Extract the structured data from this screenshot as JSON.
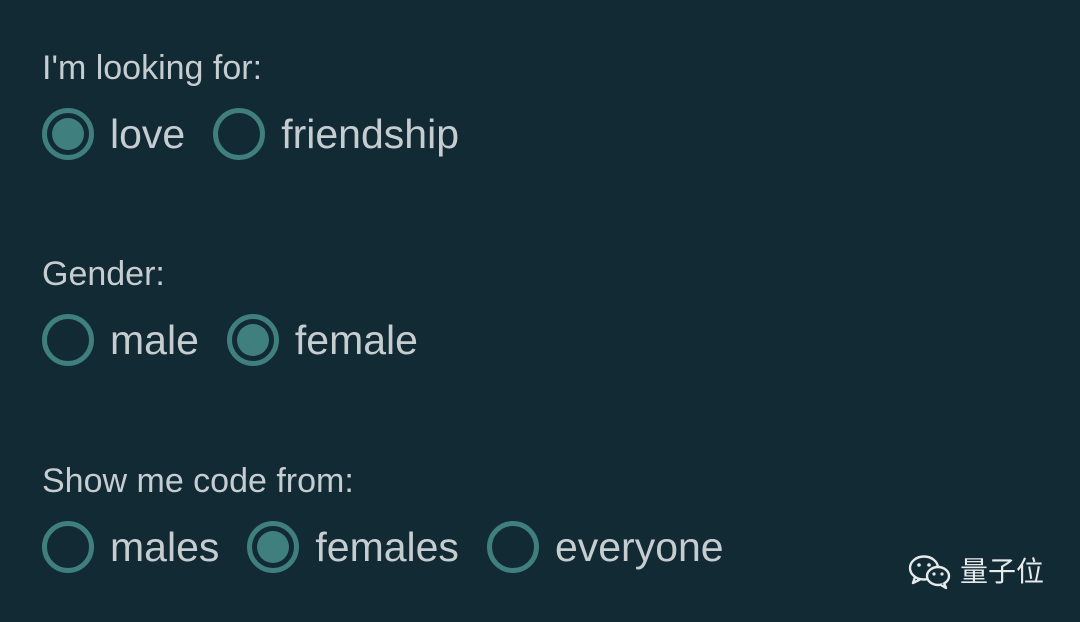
{
  "colors": {
    "background": "#122a34",
    "text": "#c5cdd0",
    "accent": "#3f7f7d"
  },
  "groups": [
    {
      "label": "I'm looking for:",
      "options": [
        {
          "label": "love",
          "checked": true
        },
        {
          "label": "friendship",
          "checked": false
        }
      ]
    },
    {
      "label": "Gender:",
      "options": [
        {
          "label": "male",
          "checked": false
        },
        {
          "label": "female",
          "checked": true
        }
      ]
    },
    {
      "label": "Show me code from:",
      "options": [
        {
          "label": "males",
          "checked": false
        },
        {
          "label": "females",
          "checked": true
        },
        {
          "label": "everyone",
          "checked": false
        }
      ]
    }
  ],
  "watermark": {
    "text": "量子位",
    "icon": "wechat-icon"
  }
}
